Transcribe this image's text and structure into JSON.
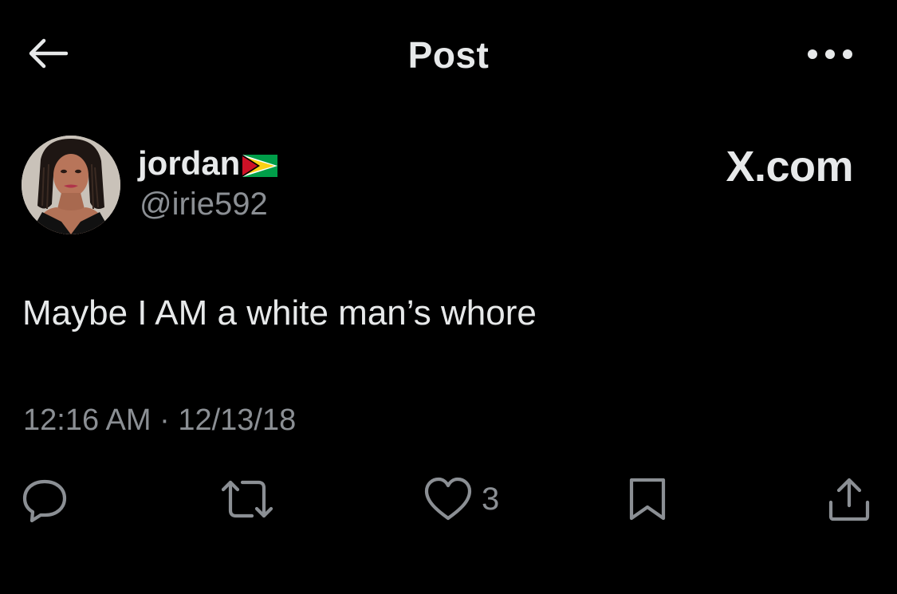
{
  "header": {
    "title": "Post",
    "back_icon": "arrow-left-icon",
    "more_icon": "more-horizontal-icon"
  },
  "author": {
    "display_name": "jordan",
    "flag_icon": "guyana-flag-icon",
    "handle": "@irie592"
  },
  "watermark": "X.com",
  "post": {
    "text": "Maybe I AM a white man’s whore",
    "timestamp": "12:16 AM · 12/13/18"
  },
  "actions": {
    "reply_icon": "reply-icon",
    "repost_icon": "repost-icon",
    "like_icon": "heart-icon",
    "like_count": "3",
    "bookmark_icon": "bookmark-icon",
    "share_icon": "share-icon"
  },
  "colors": {
    "background": "#000000",
    "primary_text": "#e7e9ea",
    "secondary_text": "#8b8f94"
  }
}
